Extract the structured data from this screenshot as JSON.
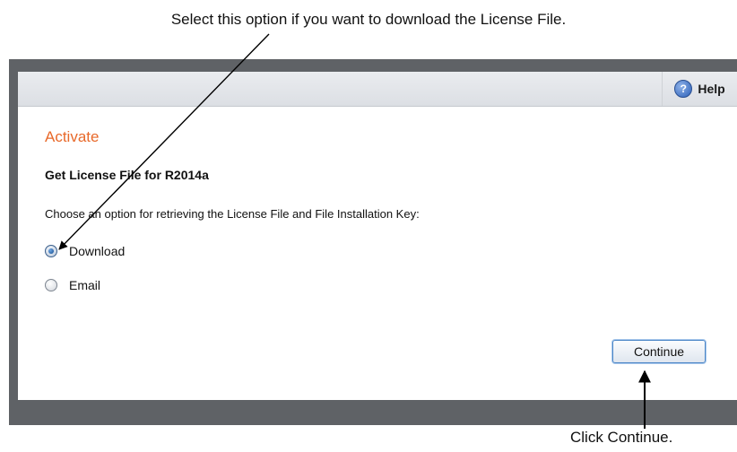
{
  "annotations": {
    "top_callout": "Select this option if you want to download the License File.",
    "bottom_callout": "Click Continue."
  },
  "toolbar": {
    "help_label": "Help",
    "help_icon": "help-question-icon"
  },
  "page": {
    "title": "Activate",
    "subtitle": "Get License File for R2014a",
    "prompt": "Choose an option for retrieving the License File and File Installation Key:"
  },
  "options": [
    {
      "label": "Download",
      "selected": true
    },
    {
      "label": "Email",
      "selected": false
    }
  ],
  "actions": {
    "continue_label": "Continue"
  },
  "colors": {
    "title_accent": "#e8692a",
    "frame": "#5f6266",
    "button_border": "#4d87c7"
  }
}
